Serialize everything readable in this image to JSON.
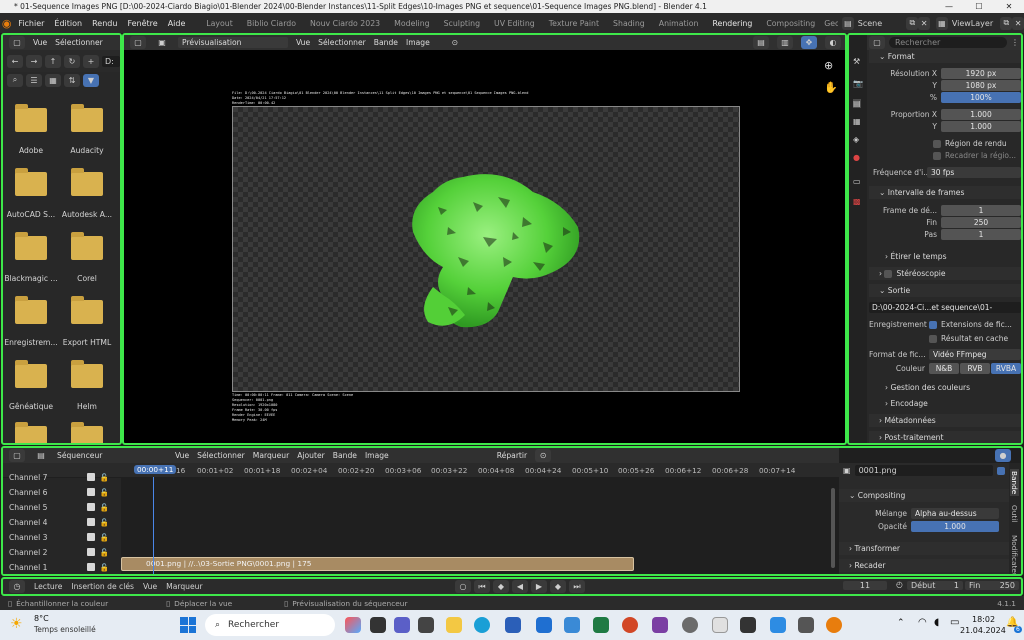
{
  "window": {
    "title": "* 01-Sequence Images PNG [D:\\00-2024-Ciardo Biagio\\01-Blender 2024\\00-Blender Instances\\11-Split Edges\\10-Images PNG et sequence\\01-Sequence Images PNG.blend] - Blender 4.1",
    "min": "—",
    "max": "☐",
    "close": "✕"
  },
  "menubar": {
    "items": [
      "Fichier",
      "Édition",
      "Rendu",
      "Fenêtre",
      "Aide"
    ],
    "workspaces": [
      "Layout",
      "Biblio Ciardo",
      "Nouv Ciardo 2023",
      "Modeling",
      "Sculpting",
      "UV Editing",
      "Texture Paint",
      "Shading",
      "Animation",
      "Rendering",
      "Compositing",
      "Geo"
    ],
    "active_workspace": "Rendering",
    "scene": "Scene",
    "view_layer": "ViewLayer"
  },
  "file_browser": {
    "menu": [
      "Vue",
      "Sélectionner"
    ],
    "path": "D:",
    "folders": [
      "Adobe",
      "Audacity",
      "AutoCAD S...",
      "Autodesk A...",
      "Blackmagic ...",
      "Corel",
      "Enregistrem...",
      "Export HTML",
      "Gênéatique",
      "Helm",
      "",
      ""
    ]
  },
  "image_editor": {
    "mode": "Prévisualisation",
    "menu": [
      "Vue",
      "Sélectionner",
      "Bande",
      "Image"
    ],
    "stamp_top": "File: D:\\00-2024 Ciardo Biagio\\01 Blender 2024\\00 Blender Instances\\11 Split Edges\\10 Images PNG et sequence\\01 Sequence Images PNG.blend",
    "stamp_date": "Date: 2024/04/21 17:57:12",
    "stamp_render": "RenderTime: 00:00.42",
    "stamp_bottom": [
      "Time: 00:00:00:11   Frame: 011   Camera: Camera   Scene: Scene",
      "Sequencer: 0001.png",
      "Resolution: 1920x1080",
      "Frame Rate: 30.00 fps",
      "Render Engine: EEVEE",
      "Memory Peak: 24M"
    ]
  },
  "properties": {
    "search_placeholder": "Rechercher",
    "format_header": "Format",
    "res_x_label": "Résolution X",
    "res_x": "1920 px",
    "res_y_label": "Y",
    "res_y": "1080 px",
    "res_pct_label": "%",
    "res_pct": "100%",
    "aspect_x_label": "Proportion X",
    "aspect_x": "1.000",
    "aspect_y_label": "Y",
    "aspect_y": "1.000",
    "render_region": "Région de rendu",
    "crop_region": "Recadrer la régio...",
    "fps_label": "Fréquence d'i...",
    "fps": "30 fps",
    "frame_range_header": "Intervalle de frames",
    "frame_start_label": "Frame de dé...",
    "frame_start": "1",
    "frame_end_label": "Fin",
    "frame_end": "250",
    "frame_step_label": "Pas",
    "frame_step": "1",
    "time_stretch": "Étirer le temps",
    "stereo": "Stéréoscopie",
    "output_header": "Sortie",
    "output_path": "D:\\00-2024-Ci...et sequence\\01-",
    "saving_label": "Enregistrement",
    "file_ext": "Extensions de fic...",
    "cache_result": "Résultat en cache",
    "file_format_label": "Format de fic...",
    "file_format": "Vidéo FFmpeg",
    "color_label": "Couleur",
    "color_modes": [
      "N&B",
      "RVB",
      "RVBA"
    ],
    "color_mgmt": "Gestion des couleurs",
    "encoding": "Encodage",
    "metadata": "Métadonnées",
    "postprocess": "Post-traitement"
  },
  "sequencer": {
    "mode": "Séquenceur",
    "menu": [
      "Vue",
      "Sélectionner",
      "Marqueur",
      "Ajouter",
      "Bande",
      "Image"
    ],
    "pivot": "Répartir",
    "current_time": "00:00+11",
    "ticks": [
      "16",
      "00:01+02",
      "00:01+18",
      "00:02+04",
      "00:02+20",
      "00:03+06",
      "00:03+22",
      "00:04+08",
      "00:04+24",
      "00:05+10",
      "00:05+26",
      "00:06+12",
      "00:06+28",
      "00:07+14"
    ],
    "channels": [
      "Channel 7",
      "Channel 6",
      "Channel 5",
      "Channel 4",
      "Channel 3",
      "Channel 2",
      "Channel 1"
    ],
    "strip_label": "0001.png | //..\\03-Sortie PNG\\0001.png | 175"
  },
  "strip_props": {
    "name": "0001.png",
    "compositing_header": "Compositing",
    "blend_label": "Mélange",
    "blend": "Alpha au-dessus",
    "opacity_label": "Opacité",
    "opacity": "1.000",
    "transform": "Transformer",
    "crop": "Recader",
    "tabs": [
      "Bande",
      "Outil",
      "Modificateur"
    ]
  },
  "timeline": {
    "menu": [
      "Lecture",
      "Insertion de clés",
      "Vue",
      "Marqueur"
    ],
    "current_frame": "11",
    "start_label": "Début",
    "start": "1",
    "end_label": "Fin",
    "end": "250"
  },
  "statusbar": {
    "hints": [
      "Échantillonner la couleur",
      "Déplacer la vue",
      "Prévisualisation du séquenceur"
    ],
    "version": "4.1.1"
  },
  "taskbar": {
    "weather_temp": "8°C",
    "weather_desc": "Temps ensoleillé",
    "search_placeholder": "Rechercher",
    "time": "18:02",
    "date": "21.04.2024",
    "notif_count": "6"
  }
}
